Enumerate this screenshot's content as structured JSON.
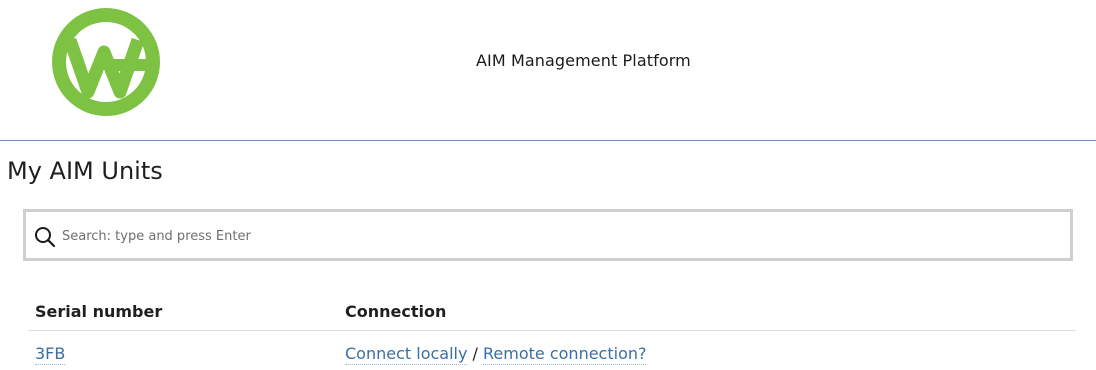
{
  "header": {
    "logo_icon": "aim-logo-icon",
    "logo_color": "#7dc242",
    "title": "AIM Management Platform",
    "rule_color": "#6b8fb8"
  },
  "main": {
    "title": "My AIM Units",
    "search": {
      "icon": "search-icon",
      "placeholder": "Search: type and press Enter",
      "value": ""
    },
    "table": {
      "columns": [
        "Serial number",
        "Connection"
      ],
      "rows": [
        {
          "serial": "3FB",
          "connect_local_label": "Connect locally",
          "separator": "/",
          "remote_label": "Remote connection?"
        }
      ]
    },
    "link_color": "#3a6ea5"
  }
}
